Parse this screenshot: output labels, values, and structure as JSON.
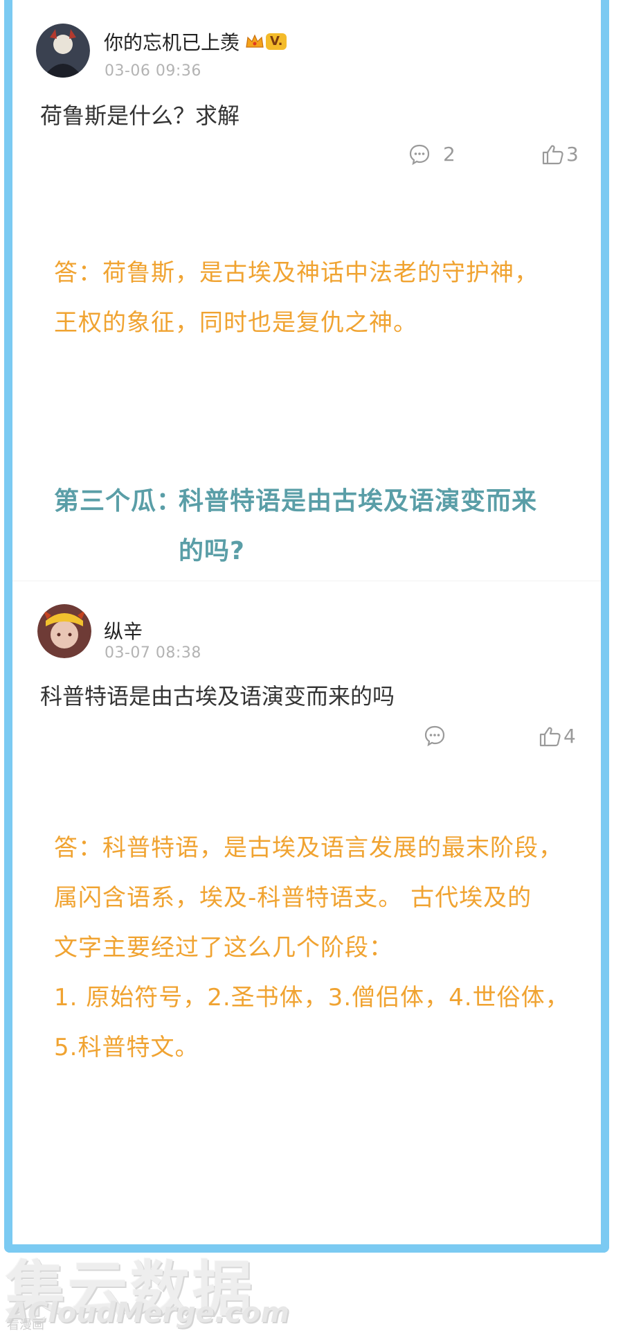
{
  "post1": {
    "username": "你的忘机已上羡",
    "badge_text": "V.",
    "time": "03-06 09:36",
    "content": "荷鲁斯是什么？求解",
    "comment_count": "2",
    "like_count": "3"
  },
  "answer1": {
    "line1": "答：荷鲁斯，是古埃及神话中法老的守护神，",
    "line2": "王权的象征，同时也是复仇之神。"
  },
  "heading": {
    "prefix": "第三个瓜：",
    "line1": "科普特语是由古埃及语演变而来",
    "line2": "的吗?"
  },
  "post2": {
    "username": "纵辛",
    "time": "03-07 08:38",
    "content": "科普特语是由古埃及语演变而来的吗",
    "like_count": "4"
  },
  "answer2": {
    "line1": "答：科普特语，是古埃及语言发展的最末阶段，",
    "line2": "属闪含语系，埃及-科普特语支。 古代埃及的",
    "line3": "文字主要经过了这么几个阶段：",
    "line4": "1. 原始符号，2.圣书体，3.僧侣体，4.世俗体，",
    "line5": "5.科普特文。"
  },
  "watermark": {
    "brand_cn": "集云数据",
    "brand_en": "ACloudMerge.com",
    "small": "看漫画"
  },
  "colors": {
    "frame": "#7bcaf2",
    "answer": "#f0a331",
    "heading": "#5a9ea7"
  },
  "icons": [
    "crown-icon",
    "comment-icon",
    "thumbs-up-icon"
  ]
}
